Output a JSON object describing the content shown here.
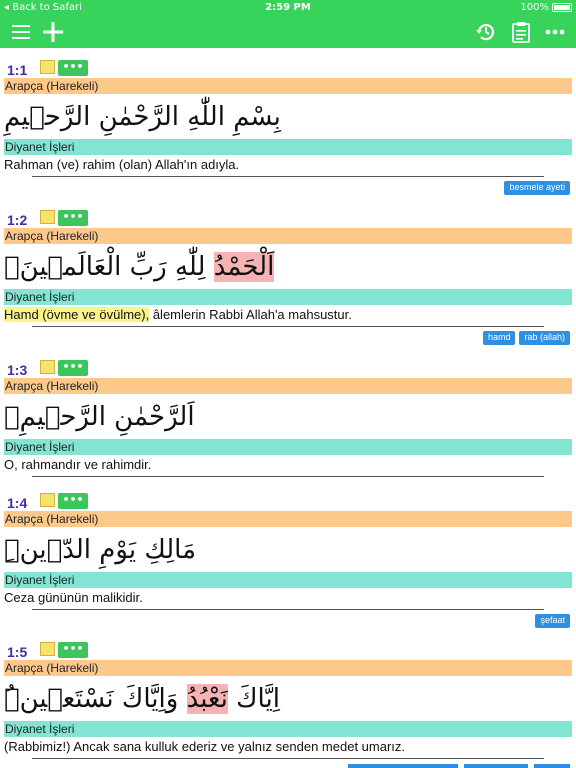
{
  "status": {
    "back_label": "Back to Safari",
    "time": "2:59 PM",
    "battery": "100%"
  },
  "toolbar": {
    "icons": [
      "menu-icon",
      "plus-icon",
      "history-icon",
      "clipboard-icon",
      "more-icon"
    ]
  },
  "colors": {
    "toolbar": "#38d35a",
    "arabic_bar": "#fdc98b",
    "translation_bar": "#82e4d2",
    "tag": "#2f8fe0",
    "verse_number": "#4a2a9a"
  },
  "more_label": "•••",
  "verses": [
    {
      "number": "1:1",
      "arabic_label": "Arapça (Harekeli)",
      "arabic": "بِسْمِ اللّٰهِ الرَّحْمٰنِ الرَّح۪يمِ",
      "translation_label": "Diyanet İşleri",
      "translation_hl": "",
      "translation": "Rahman (ve) rahim (olan) Allah'ın adıyla.",
      "tags": [
        "besmele ayeti"
      ]
    },
    {
      "number": "1:2",
      "arabic_label": "Arapça (Harekeli)",
      "arabic_hl": "اَلْحَمْدُ",
      "arabic": " لِلّٰهِ رَبِّ الْعَالَم۪ينَۙ",
      "translation_label": "Diyanet İşleri",
      "translation_hl": "Hamd (övme ve övülme),",
      "translation": " âlemlerin Rabbi Allah'a mahsustur.",
      "tags": [
        "hamd",
        "rab (allah)"
      ]
    },
    {
      "number": "1:3",
      "arabic_label": "Arapça (Harekeli)",
      "arabic": "اَلرَّحْمٰنِ الرَّح۪يمِۙ",
      "translation_label": "Diyanet İşleri",
      "translation_hl": "",
      "translation": "O, rahmandır ve rahimdir.",
      "tags": []
    },
    {
      "number": "1:4",
      "arabic_label": "Arapça (Harekeli)",
      "arabic": "مَالِكِ يَوْمِ الدّ۪ينِۜ",
      "translation_label": "Diyanet İşleri",
      "translation_hl": "",
      "translation": "Ceza gününün malikidir.",
      "tags": [
        "şefaat"
      ]
    },
    {
      "number": "1:5",
      "arabic_label": "Arapça (Harekeli)",
      "arabic_pre": "اِيَّاكَ ",
      "arabic_hl": "نَعْبُدُ",
      "arabic": " وَاِيَّاكَ نَسْتَع۪ينُۜ",
      "translation_label": "Diyanet İşleri",
      "translation_hl": "",
      "translation": "(Rabbimiz!) Ancak sana kulluk ederiz ve yalnız senden medet umarız.",
      "tags": []
    }
  ]
}
